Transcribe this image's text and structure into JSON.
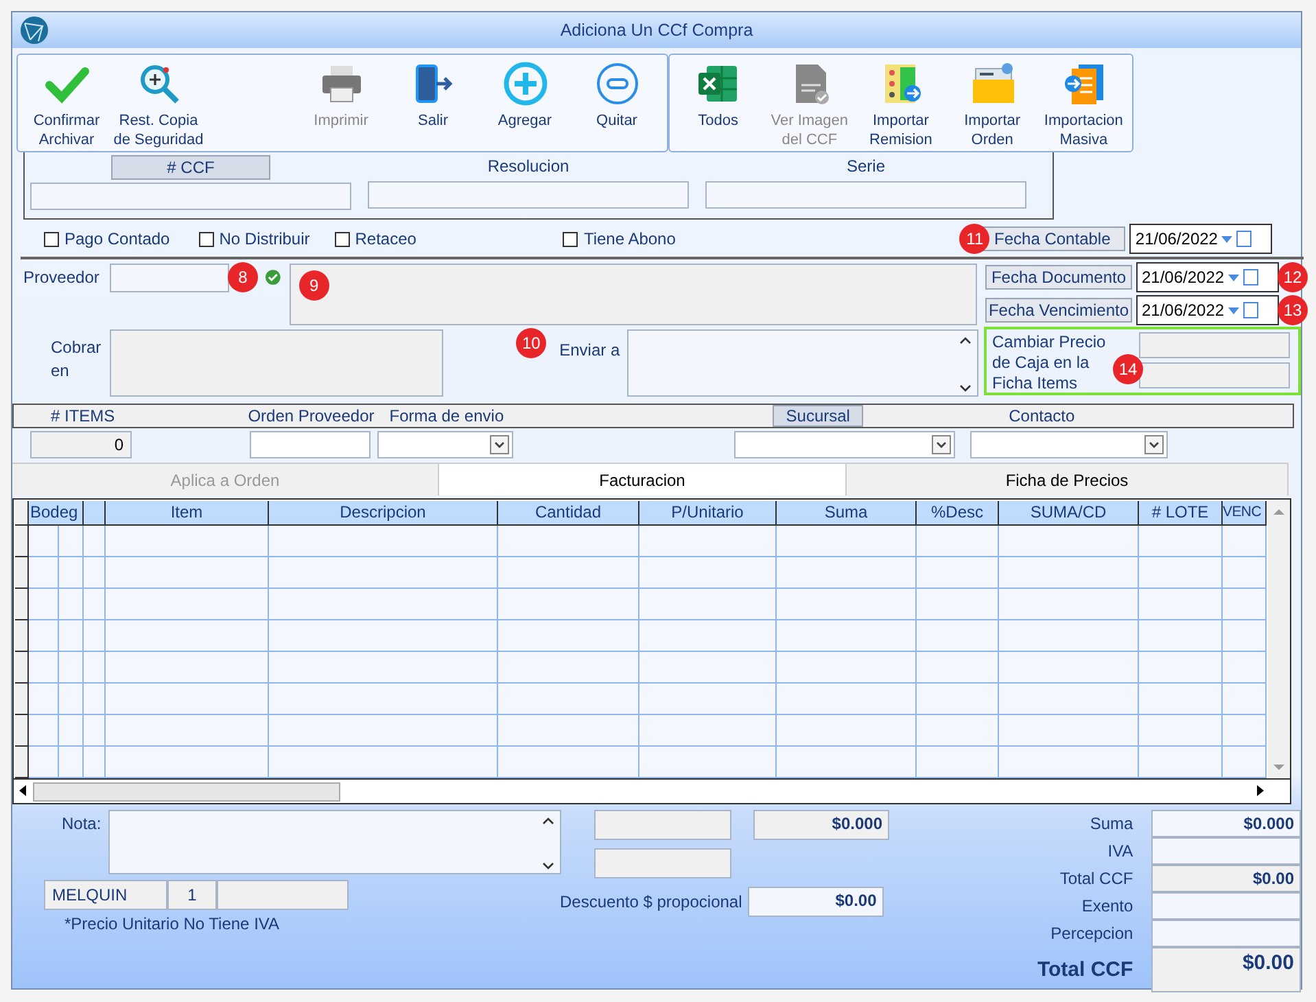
{
  "window": {
    "title": "Adiciona Un CCf Compra"
  },
  "toolbar": [
    [
      {
        "label": "Confirmar\nArchivar",
        "disabled": false
      },
      {
        "label": "Rest. Copia\nde Seguridad",
        "disabled": false
      },
      {
        "label": "Imprimir",
        "disabled": true
      },
      {
        "label": "Salir",
        "disabled": false
      },
      {
        "label": "Agregar",
        "disabled": false
      },
      {
        "label": "Quitar",
        "disabled": false
      }
    ],
    [
      {
        "label": "Todos",
        "disabled": false
      },
      {
        "label": "Ver Imagen\ndel CCF",
        "disabled": true
      },
      {
        "label": "Importar\nRemision",
        "disabled": false
      },
      {
        "label": "Importar\nOrden",
        "disabled": false
      },
      {
        "label": "Importacion\nMasiva",
        "disabled": false
      }
    ]
  ],
  "document_fields": [
    {
      "label": "# CCF",
      "kind": "button"
    },
    {
      "label": "Resolucion",
      "kind": "label"
    },
    {
      "label": "Serie",
      "kind": "label"
    }
  ],
  "options": [
    {
      "label": "Pago Contado",
      "checked": false
    },
    {
      "label": "No Distribuir",
      "checked": false
    },
    {
      "label": "Retaceo",
      "checked": false
    },
    {
      "label": "Tiene Abono",
      "checked": false
    }
  ],
  "dates": [
    {
      "label": "Fecha Contable",
      "value": "21/06/2022",
      "badge": "11"
    },
    {
      "label": "Fecha Documento",
      "value": "21/06/2022",
      "badge": "12"
    },
    {
      "label": "Fecha Vencimiento",
      "value": "21/06/2022",
      "badge": "13"
    }
  ],
  "proveedor": {
    "label": "Proveedor",
    "badge": "8",
    "name_badge": "9"
  },
  "cobrar": {
    "label": "Cobrar\nen"
  },
  "enviar": {
    "label": "Enviar a",
    "badge": "10"
  },
  "caja": {
    "label": "Cambiar Precio\nde Caja en la\nFicha Items",
    "badge": "14"
  },
  "items_bar": [
    {
      "label": "# ITEMS",
      "kind": "label"
    },
    {
      "label": "Orden Proveedor",
      "kind": "label"
    },
    {
      "label": "Forma de envio",
      "kind": "label"
    },
    {
      "label": "Sucursal",
      "kind": "button"
    },
    {
      "label": "Contacto",
      "kind": "label"
    }
  ],
  "items_count": "0",
  "tabs": [
    {
      "label": "Aplica a Orden",
      "selected": false,
      "disabled": true
    },
    {
      "label": "Facturacion",
      "selected": true,
      "disabled": false
    },
    {
      "label": "Ficha de Precios",
      "selected": false,
      "disabled": false
    }
  ],
  "table": {
    "columns": [
      "Bodeg",
      "Item",
      "Descripcion",
      "Cantidad",
      "P/Unitario",
      "Suma",
      "%Desc",
      "SUMA/CD",
      "# LOTE",
      "VENC"
    ]
  },
  "nota": {
    "label": "Nota:"
  },
  "middle": {
    "amount": "$0.000",
    "discount_label": "Descuento $ propocional",
    "discount": "$0.00"
  },
  "user": {
    "name": "MELQUIN",
    "number": "1"
  },
  "footnote": "*Precio Unitario No Tiene IVA",
  "totals": [
    {
      "label": "Suma",
      "value": "$0.000",
      "shaded": false
    },
    {
      "label": "IVA",
      "shaded": false
    },
    {
      "label": "Total CCF",
      "value": "$0.00",
      "shaded": true
    },
    {
      "label": "Exento",
      "shaded": false
    },
    {
      "label": "Percepcion",
      "shaded": false
    }
  ],
  "grand_total": {
    "label": "Total CCF",
    "value": "$0.00"
  }
}
